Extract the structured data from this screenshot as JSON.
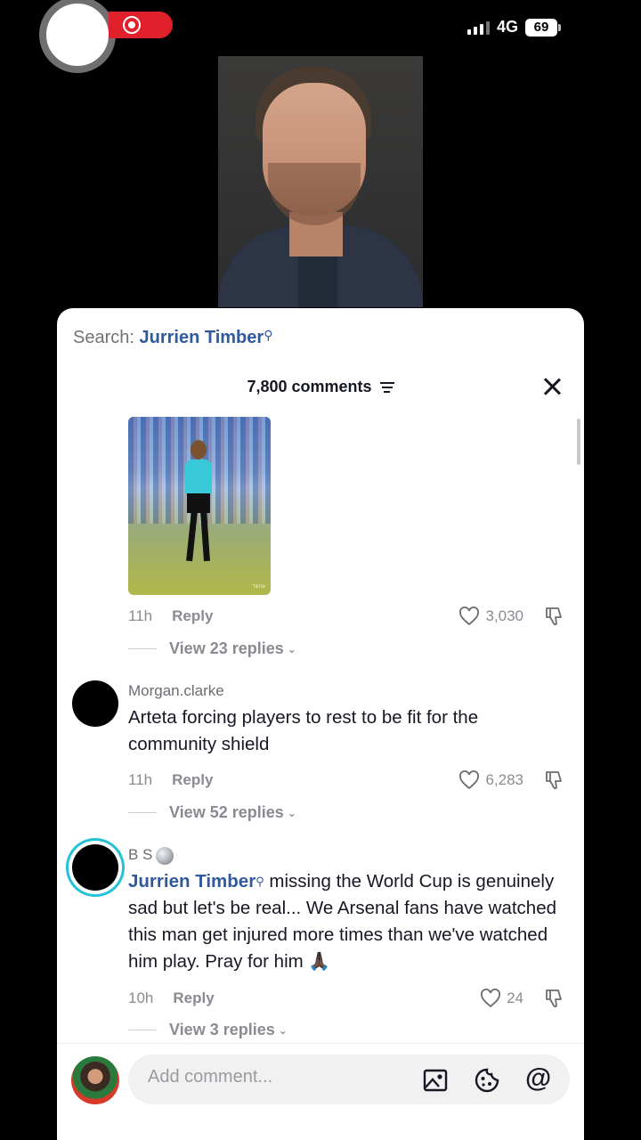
{
  "status_bar": {
    "network": "4G",
    "battery": "69"
  },
  "panel": {
    "search_prefix": "Search:",
    "search_query": "Jurrien Timber",
    "comments_count": "7,800 comments"
  },
  "comments": [
    {
      "time": "11h",
      "reply_label": "Reply",
      "likes": "3,030",
      "view_replies": "View 23 replies",
      "image_watermark": "TikTok"
    },
    {
      "username": "Morgan.clarke",
      "text": "Arteta forcing players to rest to be fit for the community shield",
      "time": "11h",
      "reply_label": "Reply",
      "likes": "6,283",
      "view_replies": "View 52 replies"
    },
    {
      "username": "B S",
      "mention": "Jurrien Timber",
      "text": " missing the World Cup is genuinely sad but let's be real... We Arsenal fans have watched this man get injured more times than we've watched him play. Pray for him ",
      "emoji": "🙏🏿",
      "time": "10h",
      "reply_label": "Reply",
      "likes": "24",
      "view_replies": "View 3 replies"
    }
  ],
  "composer": {
    "placeholder": "Add comment...",
    "icons": [
      "image-icon",
      "emoji-icon",
      "mention-icon"
    ]
  },
  "colors": {
    "accent_link": "#2f5a9e",
    "record_red": "#e0202a",
    "story_ring": "#22c3d6"
  }
}
